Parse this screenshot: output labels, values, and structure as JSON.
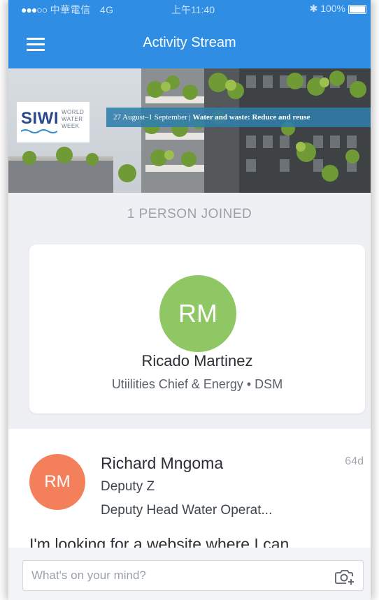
{
  "status_bar": {
    "carrier": "中華電信",
    "network": "4G",
    "time": "上午11:40",
    "battery": "100%"
  },
  "header": {
    "title": "Activity Stream",
    "menu_icon": "hamburger-menu-icon"
  },
  "banner": {
    "logo_text": "SIWI",
    "logo_subtitle": "WORLD WATER WEEK",
    "dates": "27 August–1 September",
    "theme": "Water and waste: Reduce and reuse"
  },
  "joined_section": {
    "heading": "1 PERSON JOINED",
    "person": {
      "initials": "RM",
      "name": "Ricado Martinez",
      "role": "Utiilities Chief & Energy • DSM",
      "avatar_color": "#8fc765"
    }
  },
  "post": {
    "initials": "RM",
    "author": "Richard Mngoma",
    "time_ago": "64d",
    "line1": "Deputy Z",
    "line2": "Deputy Head Water Operat...",
    "body": "I'm looking for a website where I can",
    "avatar_color": "#f4805b"
  },
  "composer": {
    "placeholder": "What's on your mind?",
    "camera_icon": "camera-add-icon"
  },
  "colors": {
    "accent": "#2f8de4",
    "background": "#eef0f3"
  }
}
